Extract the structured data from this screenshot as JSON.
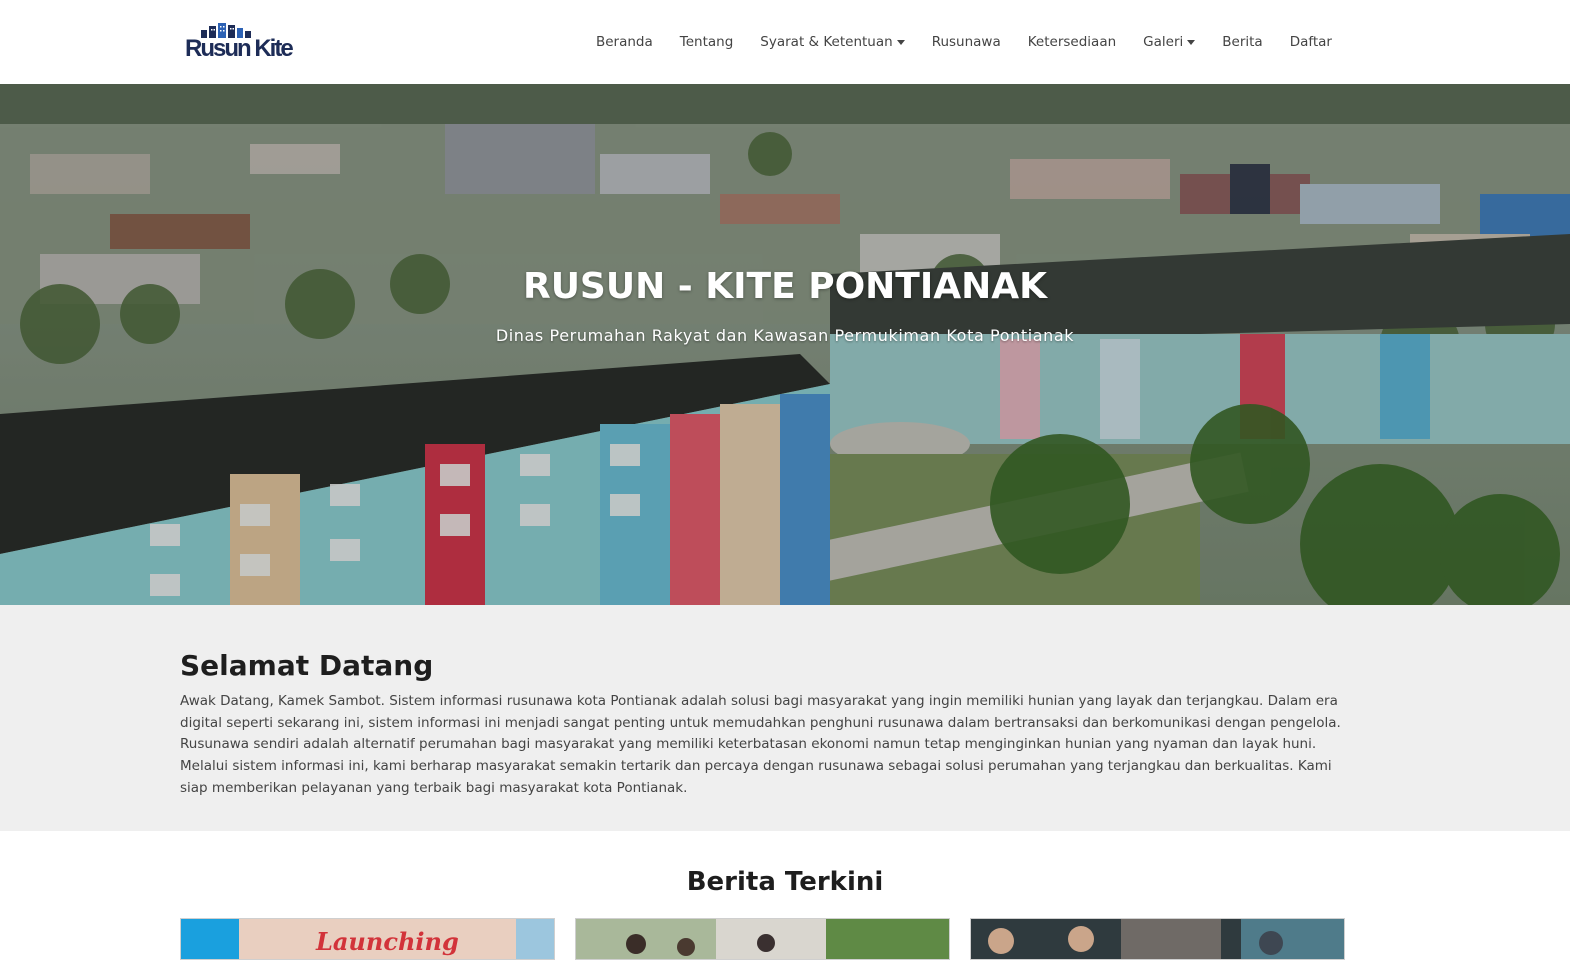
{
  "brand": {
    "name": "Rusun Kite"
  },
  "nav": {
    "items": [
      {
        "label": "Beranda"
      },
      {
        "label": "Tentang"
      },
      {
        "label": "Syarat & Ketentuan"
      },
      {
        "label": "Rusunawa"
      },
      {
        "label": "Ketersediaan"
      },
      {
        "label": "Galeri"
      },
      {
        "label": "Berita"
      },
      {
        "label": "Daftar"
      }
    ]
  },
  "hero": {
    "title": "RUSUN - KITE PONTIANAK",
    "subtitle": "Dinas Perumahan Rakyat dan Kawasan Permukiman Kota Pontianak"
  },
  "welcome": {
    "heading": "Selamat Datang",
    "body": "Awak Datang, Kamek Sambot. Sistem informasi rusunawa kota Pontianak adalah solusi bagi masyarakat yang ingin memiliki hunian yang layak dan terjangkau. Dalam era digital seperti sekarang ini, sistem informasi ini menjadi sangat penting untuk memudahkan penghuni rusunawa dalam bertransaksi dan berkomunikasi dengan pengelola. Rusunawa sendiri adalah alternatif perumahan bagi masyarakat yang memiliki keterbatasan ekonomi namun tetap menginginkan hunian yang nyaman dan layak huni. Melalui sistem informasi ini, kami berharap masyarakat semakin tertarik dan percaya dengan rusunawa sebagai solusi perumahan yang terjangkau dan berkualitas. Kami siap memberikan pelayanan yang terbaik bagi masyarakat kota Pontianak."
  },
  "news": {
    "heading": "Berita Terkini",
    "cards": [
      {
        "image_text": "Launching"
      },
      {
        "image_text": ""
      },
      {
        "image_text": ""
      }
    ]
  },
  "colors": {
    "brand": "#1d2c57",
    "accent": "#d2333a",
    "section_bg": "#efefef"
  }
}
